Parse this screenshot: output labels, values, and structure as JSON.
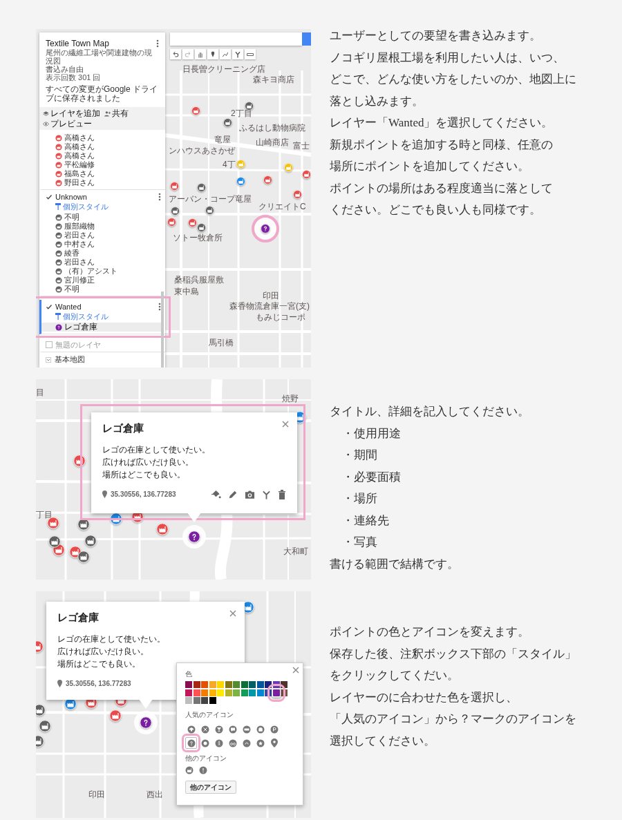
{
  "steps": [
    {
      "kind": "layers",
      "screen": {
        "sidebar": {
          "title": "Textile Town Map",
          "description": [
            "尾州の繊維工場や関連建物の現況図",
            "書込み自由",
            "表示回数 301 回"
          ],
          "save_status": "すべての変更がGoogle ドライブに保存されました",
          "actions": [
            "レイヤを追加",
            "共有",
            "プレビュー"
          ],
          "layers": [
            {
              "selected": false,
              "items": [
                {
                  "label": "高橋さん",
                  "kind": "factory",
                  "color": "#e84b4b",
                  "selected": false
                },
                {
                  "label": "高橋さん",
                  "kind": "factory",
                  "color": "#e84b4b",
                  "selected": false
                },
                {
                  "label": "高橋さん",
                  "kind": "factory",
                  "color": "#e84b4b",
                  "selected": false
                },
                {
                  "label": "平松編修",
                  "kind": "factory",
                  "color": "#e84b4b",
                  "selected": false
                },
                {
                  "label": "福島さん",
                  "kind": "factory",
                  "color": "#e84b4b",
                  "selected": false
                },
                {
                  "label": "野田さん",
                  "kind": "factory",
                  "color": "#e84b4b",
                  "selected": false
                }
              ]
            },
            {
              "name": "Unknown",
              "checked": true,
              "style_link": "個別スタイル",
              "selected": false,
              "items": [
                {
                  "label": "不明",
                  "kind": "factory",
                  "color": "#616161",
                  "selected": false
                },
                {
                  "label": "服部織物",
                  "kind": "factory",
                  "color": "#616161",
                  "selected": false
                },
                {
                  "label": "岩田さん",
                  "kind": "factory",
                  "color": "#616161",
                  "selected": false
                },
                {
                  "label": "中村さん",
                  "kind": "factory",
                  "color": "#616161",
                  "selected": false
                },
                {
                  "label": "綾香",
                  "kind": "factory",
                  "color": "#616161",
                  "selected": false
                },
                {
                  "label": "岩田さん",
                  "kind": "factory",
                  "color": "#616161",
                  "selected": false
                },
                {
                  "label": "（有）アシスト",
                  "kind": "factory",
                  "color": "#616161",
                  "selected": false
                },
                {
                  "label": "宮川修正",
                  "kind": "factory",
                  "color": "#616161",
                  "selected": false
                },
                {
                  "label": "不明",
                  "kind": "factory",
                  "color": "#616161",
                  "selected": false
                }
              ]
            },
            {
              "name": "Wanted",
              "checked": true,
              "style_link": "個別スタイル",
              "selected": true,
              "items": [
                {
                  "label": "レゴ倉庫",
                  "kind": "question",
                  "color": "#7b1fa2",
                  "selected": true
                }
              ]
            },
            {
              "name": "無題のレイヤ",
              "checked": false,
              "selected": false
            }
          ],
          "base_map": {
            "label": "基本地図",
            "expanded": false
          }
        },
        "map_labels": [
          "日長曽クリーニング店",
          "森キヨ商店",
          "2丁目",
          "竜屋",
          "ふるはし動物病院",
          "山崎商店",
          "富士",
          "ンハウスあさかぜ",
          "4丁",
          "アーバン・コープ竜屋",
          "クリエイトC",
          "ソトー牧倉所",
          "桑稲呉服屋敷",
          "東中島",
          "印田",
          "森香物流倉庫一宮(支)",
          "もみじコーポ",
          "馬引橋"
        ]
      },
      "caption": {
        "lines": [
          "ユーザーとしての要望を書き込みます。",
          "ノコギリ屋根工場を利用したい人は、いつ、",
          "どこで、どんな使い方をしたいのか、地図上に",
          "落とし込みます。",
          "レイヤー「Wanted」を選択してください。",
          "新規ポイントを追加する時と同様、任意の",
          "場所にポイントを追加してください。",
          "ポイントの場所はある程度適当に落として",
          "ください。どこでも良い人も同様です。"
        ]
      }
    },
    {
      "kind": "popup",
      "screen": {
        "popup": {
          "title": "レゴ倉庫",
          "description": [
            "レゴの在庫として使いたい。",
            "広ければ広いだけ良い。",
            "場所はどこでも良い。"
          ],
          "coordinates": "35.30556, 136.77283"
        },
        "map_labels": [
          "目",
          "焼野",
          "丁目",
          "大和町"
        ]
      },
      "caption": {
        "lines": [
          "タイトル、詳細を記入してください。"
        ],
        "items": [
          "・使用用途",
          "・期間",
          "・必要面積",
          "・場所",
          "・連絡先",
          "・写真"
        ],
        "after": [
          "書ける範囲で結構です。"
        ]
      }
    },
    {
      "kind": "style",
      "screen": {
        "popup": {
          "title": "レゴ倉庫",
          "description": [
            "レゴの在庫として使いたい。",
            "広ければ広いだけ良い。",
            "場所はどこでも良い。"
          ],
          "coordinates": "35.30556, 136.77283"
        },
        "style_panel": {
          "color_label": "色",
          "colors": [
            {
              "color": "#880e4f",
              "selected": false
            },
            {
              "color": "#a52714",
              "selected": false
            },
            {
              "color": "#e65100",
              "selected": false
            },
            {
              "color": "#f9a825",
              "selected": false
            },
            {
              "color": "#ffd600",
              "selected": false
            },
            {
              "color": "#817717",
              "selected": false
            },
            {
              "color": "#558b2f",
              "selected": false
            },
            {
              "color": "#097138",
              "selected": false
            },
            {
              "color": "#006064",
              "selected": false
            },
            {
              "color": "#01579b",
              "selected": false
            },
            {
              "color": "#1a237e",
              "selected": false
            },
            {
              "color": "#673ab7",
              "selected": false
            },
            {
              "color": "#4e342e",
              "selected": false
            },
            {
              "color": "#c2185b",
              "selected": false
            },
            {
              "color": "#ff5252",
              "selected": false
            },
            {
              "color": "#f57c00",
              "selected": false
            },
            {
              "color": "#ffb300",
              "selected": false
            },
            {
              "color": "#ffea00",
              "selected": false
            },
            {
              "color": "#afb42b",
              "selected": false
            },
            {
              "color": "#7cb342",
              "selected": false
            },
            {
              "color": "#0f9d58",
              "selected": false
            },
            {
              "color": "#0097a7",
              "selected": false
            },
            {
              "color": "#0288d1",
              "selected": false
            },
            {
              "color": "#3949ab",
              "selected": false
            },
            {
              "color": "#7b1fa2",
              "selected": true
            },
            {
              "color": "#795548",
              "selected": false
            },
            {
              "color": "#bdbdbd",
              "selected": false
            },
            {
              "color": "#757575",
              "selected": false
            },
            {
              "color": "#424242",
              "selected": false
            },
            {
              "color": "#000000",
              "selected": false
            }
          ],
          "popular_label": "人気のアイコン",
          "popular_icons": [
            {
              "selected": false
            },
            {
              "selected": false
            },
            {
              "selected": false
            },
            {
              "selected": false
            },
            {
              "selected": false
            },
            {
              "selected": false
            },
            {
              "selected": false
            },
            {
              "selected": true
            },
            {
              "selected": false
            },
            {
              "selected": false
            },
            {
              "selected": false
            },
            {
              "selected": false
            },
            {
              "selected": false
            },
            {
              "selected": false
            }
          ],
          "other_label": "他のアイコン",
          "more_button": "他のアイコン"
        },
        "map_labels": [
          "印田",
          "西出"
        ]
      },
      "caption": {
        "lines": [
          "ポイントの色とアイコンを変えます。",
          "保存した後、注釈ボックス下部の「スタイル」",
          "をクリックしてくだい。",
          "レイヤーのに合わせた色を選択し、",
          "「人気のアイコン」から？マークのアイコンを",
          "選択してください。"
        ]
      }
    }
  ]
}
